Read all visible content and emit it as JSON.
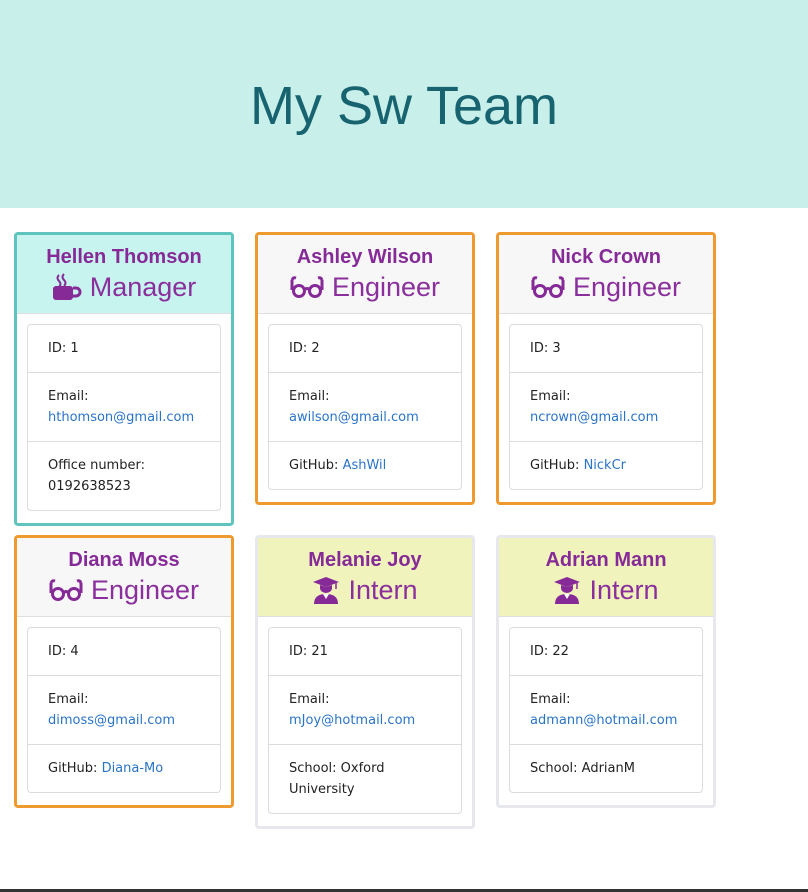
{
  "header": {
    "title": "My Sw Team"
  },
  "labels": {
    "id": "ID: ",
    "email": "Email:",
    "github": "GitHub: ",
    "office": "Office number:",
    "school": "School: "
  },
  "employees": [
    {
      "name": "Hellen Thomson",
      "role": "Manager",
      "icon": "coffee-mug-icon",
      "id": "1",
      "email": "hthomson@gmail.com",
      "office": "0192638523"
    },
    {
      "name": "Ashley Wilson",
      "role": "Engineer",
      "icon": "glasses-icon",
      "id": "2",
      "email": "awilson@gmail.com",
      "github": "AshWil"
    },
    {
      "name": "Nick Crown",
      "role": "Engineer",
      "icon": "glasses-icon",
      "id": "3",
      "email": "ncrown@gmail.com",
      "github": "NickCr"
    },
    {
      "name": "Diana Moss",
      "role": "Engineer",
      "icon": "glasses-icon",
      "id": "4",
      "email": "dimoss@gmail.com",
      "github": "Diana-Mo"
    },
    {
      "name": "Melanie Joy",
      "role": "Intern",
      "icon": "graduate-icon",
      "id": "21",
      "email": "mJoy@hotmail.com",
      "school": "Oxford University"
    },
    {
      "name": "Adrian Mann",
      "role": "Intern",
      "icon": "graduate-icon",
      "id": "22",
      "email": "admann@hotmail.com",
      "school": "AdrianM"
    }
  ],
  "colors": {
    "header_bg": "#c8efea",
    "title": "#176470",
    "name": "#862a98",
    "link": "#2a74c8",
    "manager_border": "#5fc4bd",
    "engineer_border": "#ef9a2f",
    "intern_header": "#f1f3bc"
  }
}
